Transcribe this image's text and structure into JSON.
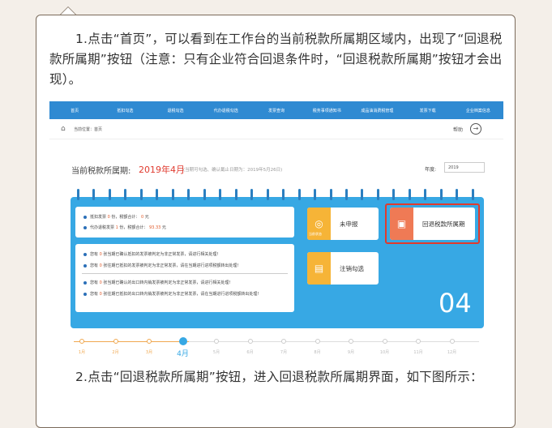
{
  "paragraph1": "1.点击“首页”，可以看到在工作台的当前税款所属期区域内，出现了“回退税款所属期”按钮（注意：只有企业符合回退条件时，“回退税款所属期”按钮才会出现）。",
  "paragraph2": "2.点击“回退税款所属期”按钮，进入回退税款所属期界面，如下图所示：",
  "screenshot": {
    "nav": [
      "首页",
      "抵扣勾选",
      "退税勾选",
      "代办退税勾选",
      "发票查询",
      "税务事项通知书",
      "成品油消费税管理",
      "发票下载",
      "企业档案信息"
    ],
    "crumb_label": "当前位置：首页",
    "help": "帮助",
    "period_title": "当前税款所属期:",
    "period_value": "2019年4月",
    "period_note": "(当期可勾选、确认截止日期为：2019年5月26日)",
    "year_label": "年度:",
    "year_value": "2019",
    "summary": {
      "line1": {
        "prefix": "抵扣发票",
        "count": "0",
        "mid": "份，税额合计：",
        "amount": "0",
        "suffix": "元"
      },
      "line2": {
        "prefix": "代办退税发票",
        "count": "1",
        "mid": "份，税额合计：",
        "amount": "93.33",
        "suffix": "元"
      }
    },
    "notices": [
      {
        "pre": "您有",
        "n": "0",
        "post": "张当期已确认抵扣的发票被判定为非正常发票，请进行相关处理!"
      },
      {
        "pre": "您有",
        "n": "0",
        "post": "张往期已抵扣的发票被判定为非正常发票，请在当期进行进项税额转出处理!"
      },
      {
        "pre": "您有",
        "n": "0",
        "post": "张当期已确认的出口转内销发票被判定为非正常发票，请进行相关处理!"
      },
      {
        "pre": "您有",
        "n": "0",
        "post": "张往期已抵扣的出口转内销发票被判定为非正常发票，请在当期进行进项税额转出处理!"
      }
    ],
    "tiles": {
      "undeclared": "未申报",
      "undeclared_badge": "当前状态",
      "rollback": "回退税款所属期",
      "cancel": "注销勾选"
    },
    "month_big": "04",
    "timeline": [
      "1月",
      "2月",
      "3月",
      "4月",
      "5月",
      "6月",
      "7月",
      "8月",
      "9月",
      "10月",
      "11月",
      "12月"
    ],
    "current_month_index": 3,
    "colors": {
      "nav": "#2f8ad2",
      "calendar": "#37a8e4",
      "highlight": "#e23a2c",
      "period": "#e03b2f"
    }
  }
}
